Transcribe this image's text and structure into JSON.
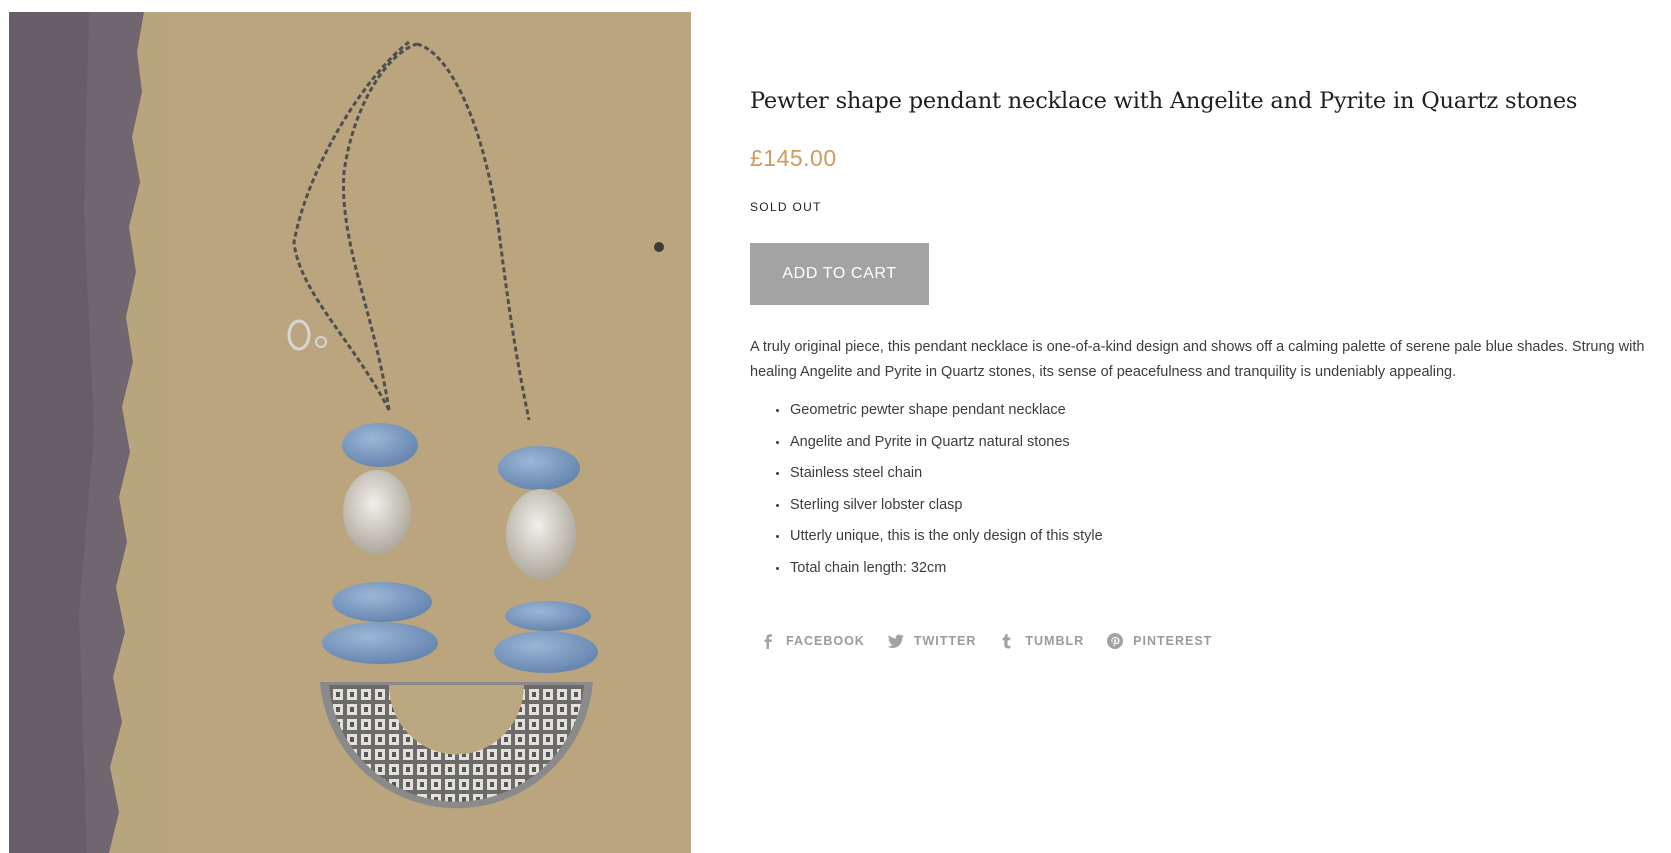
{
  "product": {
    "title": "Pewter shape pendant necklace with Angelite and Pyrite in Quartz stones",
    "price": "£145.00",
    "stock_status": "SOLD OUT",
    "add_to_cart_label": "ADD TO CART",
    "description": "A truly original piece, this pendant necklace is one-of-a-kind design and shows off a calming palette of serene pale blue shades. Strung with healing Angelite and Pyrite in Quartz stones, its sense of peacefulness and tranquility is undeniably appealing.",
    "features": [
      "Geometric pewter shape pendant necklace",
      "Angelite and Pyrite in Quartz natural stones",
      "Stainless steel chain",
      "Sterling silver lobster clasp",
      "Utterly unique, this is the only design of this style",
      "Total chain length: 32cm"
    ]
  },
  "share": [
    {
      "label": "FACEBOOK",
      "icon": "facebook-icon"
    },
    {
      "label": "TWITTER",
      "icon": "twitter-icon"
    },
    {
      "label": "TUMBLR",
      "icon": "tumblr-icon"
    },
    {
      "label": "PINTEREST",
      "icon": "pinterest-icon"
    }
  ],
  "colors": {
    "price": "#d19a5e",
    "button_disabled": "#a3a3a3",
    "share_text": "#9b9b9b",
    "stone_blue": "#7a9bc4",
    "paper": "#b7a47e"
  }
}
